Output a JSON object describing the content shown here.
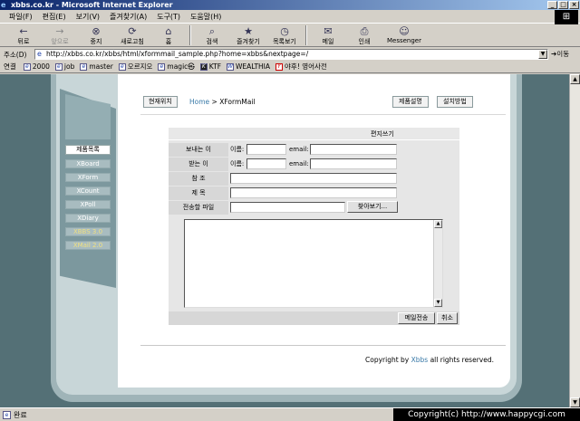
{
  "window": {
    "title": "xbbs.co.kr - Microsoft Internet Explorer",
    "controls": [
      "_",
      "□",
      "×"
    ]
  },
  "menubar": [
    "파일(F)",
    "편집(E)",
    "보기(V)",
    "즐겨찾기(A)",
    "도구(T)",
    "도움말(H)"
  ],
  "toolbar": [
    {
      "label": "뒤로",
      "icon": "back-arrow-icon",
      "glyph": "←",
      "enabled": true
    },
    {
      "label": "앞으로",
      "icon": "forward-arrow-icon",
      "glyph": "→",
      "enabled": false
    },
    {
      "label": "중지",
      "icon": "stop-icon",
      "glyph": "⊗",
      "enabled": true
    },
    {
      "label": "새로고침",
      "icon": "refresh-icon",
      "glyph": "⟳",
      "enabled": true
    },
    {
      "label": "홈",
      "icon": "home-icon",
      "glyph": "⌂",
      "enabled": true
    },
    {
      "label": "검색",
      "icon": "search-icon",
      "glyph": "⌕",
      "enabled": true
    },
    {
      "label": "즐겨찾기",
      "icon": "favorites-icon",
      "glyph": "★",
      "enabled": true
    },
    {
      "label": "목록보기",
      "icon": "history-icon",
      "glyph": "◷",
      "enabled": true
    },
    {
      "label": "메일",
      "icon": "mail-icon",
      "glyph": "✉",
      "enabled": true
    },
    {
      "label": "인쇄",
      "icon": "print-icon",
      "glyph": "⎙",
      "enabled": true
    },
    {
      "label": "Messenger",
      "icon": "messenger-icon",
      "glyph": "☺",
      "enabled": true
    }
  ],
  "address": {
    "label": "주소(D)",
    "url": "http://xbbs.co.kr/xbbs/html/xformmail_sample.php?home=xbbs&nextpage=/",
    "go": "이동"
  },
  "links": {
    "label": "연결",
    "items": [
      "2000",
      "job",
      "master",
      "오르지오",
      "magic㉿",
      "KTF",
      "WEALTHIA",
      "야후! 영어사전"
    ]
  },
  "page": {
    "left_menu": {
      "title": "제품목록",
      "items": [
        "XBoard",
        "XForm",
        "XCount",
        "XPoll",
        "XDiary",
        "XBBS 3.0",
        "XMail 2.0"
      ]
    },
    "breadcrumb": {
      "button": "현재위치",
      "home": "Home",
      "separator": ">",
      "current": "XFormMail"
    },
    "top_buttons": {
      "product": "제품설명",
      "install": "설치방법"
    },
    "form": {
      "title": "편지쓰기",
      "sender_label": "보내는 이",
      "receiver_label": "받는 이",
      "name_label": "이름:",
      "email_label": "email:",
      "cc_label": "참 조",
      "subject_label": "제 목",
      "file_label": "전송할 파일",
      "browse_button": "찾아보기...",
      "send_button": "메일전송",
      "cancel_button": "취소"
    },
    "copyright": {
      "prefix": "Copyright by ",
      "brand": "Xbbs",
      "suffix": " all rights reserved."
    }
  },
  "status": {
    "text": "완료"
  },
  "overlay": "Copyright(c) http://www.happycgi.com"
}
